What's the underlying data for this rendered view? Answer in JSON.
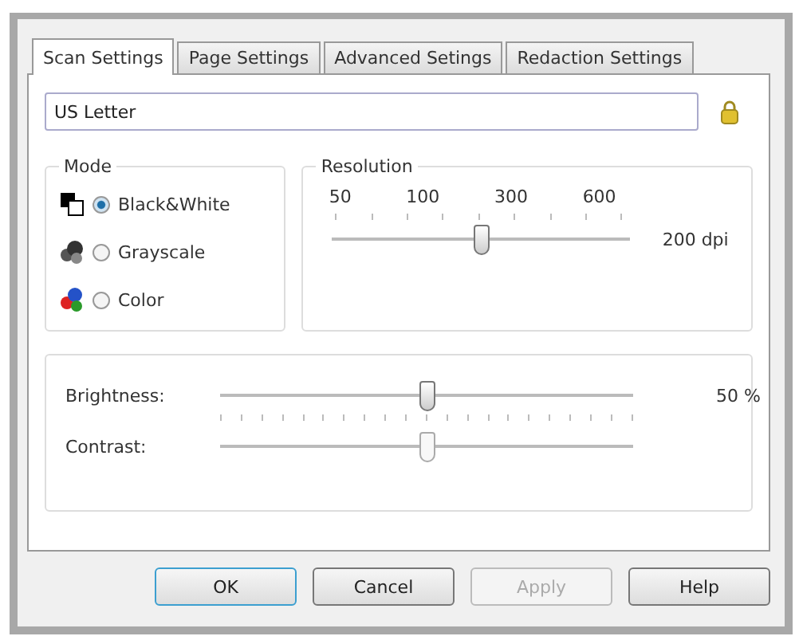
{
  "tabs": [
    {
      "label": "Scan Settings",
      "selected": true
    },
    {
      "label": "Page Settings",
      "selected": false
    },
    {
      "label": "Advanced Setings",
      "selected": false
    },
    {
      "label": "Redaction Settings",
      "selected": false
    }
  ],
  "preset": {
    "value": "US Letter"
  },
  "mode": {
    "title": "Mode",
    "options": [
      {
        "kind": "bw",
        "label": "Black&White",
        "selected": true
      },
      {
        "kind": "gray",
        "label": "Grayscale",
        "selected": false
      },
      {
        "kind": "color",
        "label": "Color",
        "selected": false
      }
    ]
  },
  "resolution": {
    "title": "Resolution",
    "tick_labels": [
      "50",
      "100",
      "300",
      "600"
    ],
    "level": 0.5,
    "reading": "200 dpi"
  },
  "adjustments": [
    {
      "label": "Brightness:",
      "level": 0.5,
      "reading": "50 %",
      "active": true
    },
    {
      "label": "Contrast:",
      "level": 0.5,
      "active": false
    }
  ],
  "buttons": [
    {
      "label": "OK",
      "default": true,
      "disabled": false
    },
    {
      "label": "Cancel",
      "default": false,
      "disabled": false
    },
    {
      "label": "Apply",
      "default": false,
      "disabled": true
    },
    {
      "label": "Help",
      "default": false,
      "disabled": false
    }
  ]
}
